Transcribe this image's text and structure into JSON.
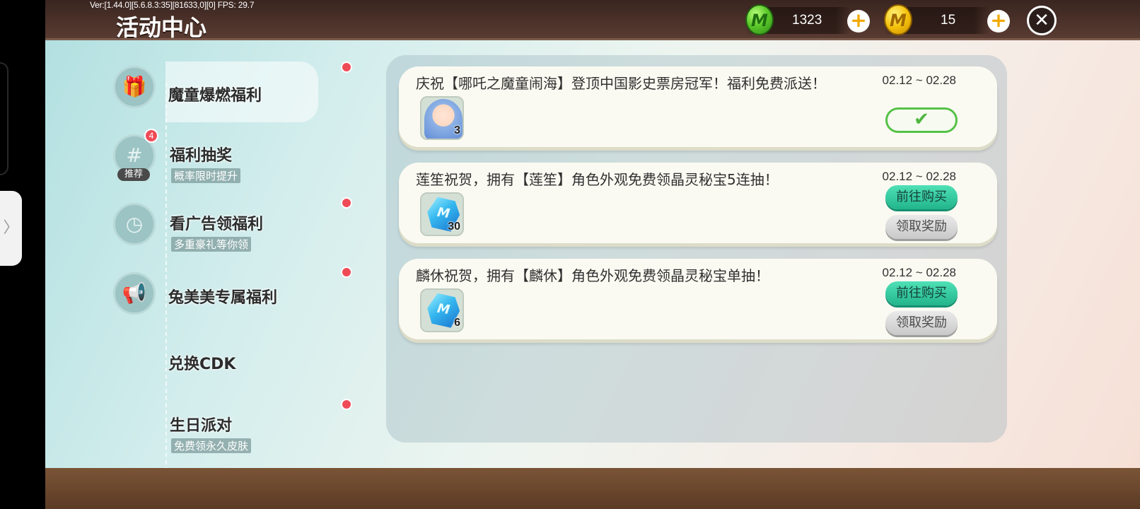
{
  "debug": {
    "version_text": "Ver:[1.44.0][5.6.8.3:35][81633,0][0] FPS: 29.7"
  },
  "header": {
    "title": "活动中心",
    "gems": {
      "icon": "green-gem-icon",
      "letter": "M",
      "value": "1323"
    },
    "coins": {
      "icon": "gold-coin-icon",
      "letter": "M",
      "value": "15"
    },
    "plus_glyph": "+",
    "close_glyph": "✕"
  },
  "sidebar": {
    "items": [
      {
        "label": "魔童爆燃福利",
        "icon": "gift-icon",
        "glyph": "🎁",
        "active": true,
        "red_dot": true
      },
      {
        "label": "福利抽奖",
        "sub": "概率限时提升",
        "icon": "hashtag-icon",
        "glyph": "#",
        "badge": "4",
        "tag": "推荐"
      },
      {
        "label": "看广告领福利",
        "sub": "多重豪礼等你领",
        "icon": "clock-icon",
        "glyph": "◷",
        "red_dot": true
      },
      {
        "label": "兔美美专属福利",
        "icon": "megaphone-icon",
        "glyph": "📢",
        "red_dot": true
      },
      {
        "label": "兑换CDK"
      },
      {
        "label": "生日派对",
        "sub": "免费领永久皮肤",
        "red_dot": true
      }
    ]
  },
  "activities": [
    {
      "title": "庆祝【哪吒之魔童闹海】登顶中国影史票房冠军！福利免费派送！",
      "date": "02.12 ~ 02.28",
      "item": {
        "icon": "character-avatar-icon",
        "qty": "3"
      },
      "state": "claimed",
      "check_glyph": "✔"
    },
    {
      "title": "莲笙祝贺，拥有【莲笙】角色外观免费领晶灵秘宝5连抽！",
      "date": "02.12 ~ 02.28",
      "item": {
        "icon": "blue-crystal-icon",
        "letter": "M",
        "qty": "30"
      },
      "buy_label": "前往购买",
      "claim_label": "领取奖励"
    },
    {
      "title": "麟休祝贺，拥有【麟休】角色外观免费领晶灵秘宝单抽！",
      "date": "02.12 ~ 02.28",
      "item": {
        "icon": "blue-crystal-icon",
        "letter": "M",
        "qty": "6"
      },
      "buy_label": "前往购买",
      "claim_label": "领取奖励"
    }
  ],
  "edge_tab": {
    "icon": "chevron-right-icon",
    "glyph": "〉"
  }
}
